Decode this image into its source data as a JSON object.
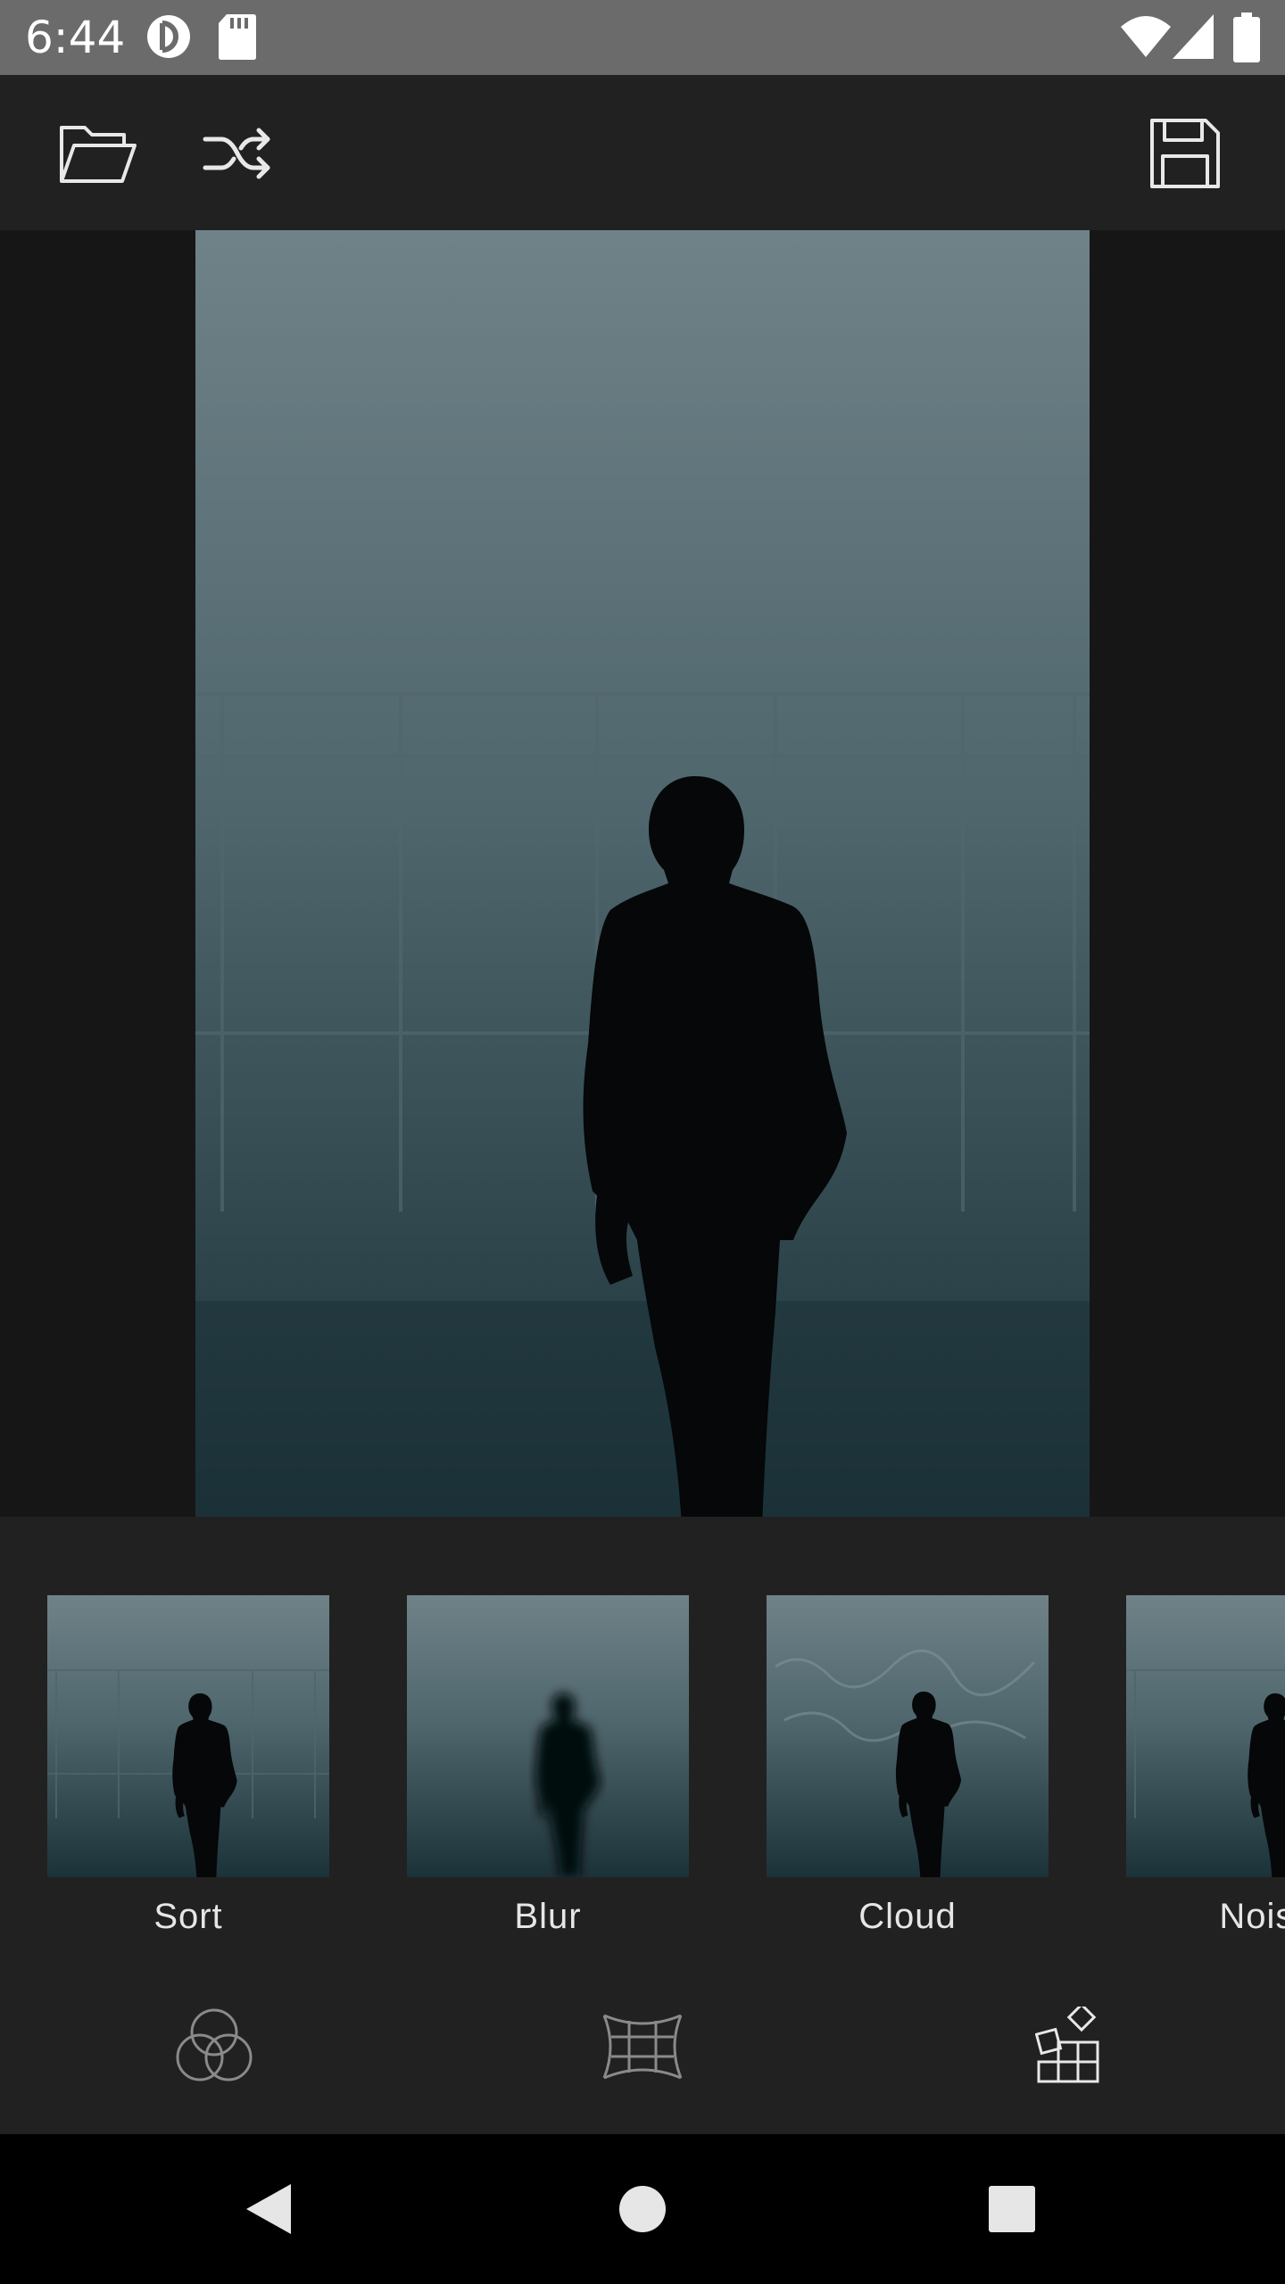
{
  "status_bar": {
    "time": "6:44",
    "icons": [
      "sync-icon",
      "sd-card-icon",
      "wifi-icon",
      "signal-icon",
      "battery-icon"
    ]
  },
  "toolbar": {
    "icons": [
      "folder-open-icon",
      "shuffle-icon",
      "save-icon"
    ]
  },
  "filters": {
    "items": [
      {
        "label": "Sort",
        "icon": "filter-thumb-sort"
      },
      {
        "label": "Blur",
        "icon": "filter-thumb-blur"
      },
      {
        "label": "Cloud",
        "icon": "filter-thumb-cloud"
      },
      {
        "label": "Noise",
        "icon": "filter-thumb-noise"
      }
    ]
  },
  "tabs": {
    "icons": [
      "color-circles-icon",
      "grid-warp-icon",
      "effects-blocks-icon"
    ]
  },
  "nav": {
    "icons": [
      "back-icon",
      "home-icon",
      "recents-icon"
    ]
  },
  "colors": {
    "statusbar": "#6b6b6b",
    "toolbar": "#212121",
    "canvas": "#161616",
    "fog_top": "#6e8187",
    "fog_bottom": "#1d333a"
  }
}
